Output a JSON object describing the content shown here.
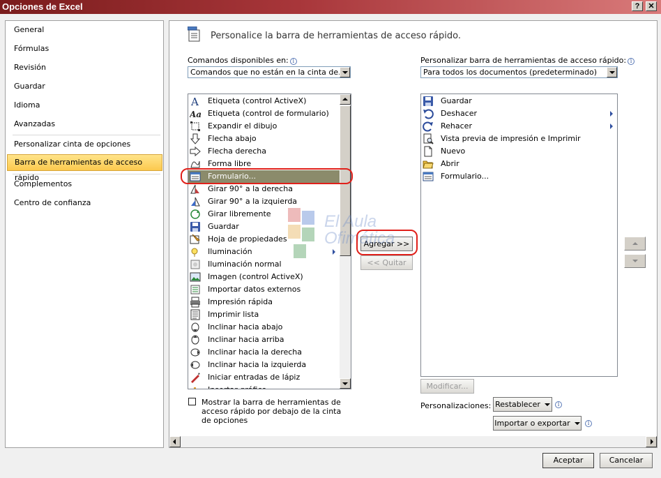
{
  "window": {
    "title": "Opciones de Excel",
    "help_button": "?",
    "close_button": "✕"
  },
  "nav": {
    "items": [
      {
        "label": "General"
      },
      {
        "label": "Fórmulas"
      },
      {
        "label": "Revisión"
      },
      {
        "label": "Guardar"
      },
      {
        "label": "Idioma"
      },
      {
        "label": "Avanzadas"
      },
      {
        "label": "Personalizar cinta de opciones"
      },
      {
        "label": "Barra de herramientas de acceso rápido",
        "selected": true
      },
      {
        "label": "Complementos"
      },
      {
        "label": "Centro de confianza"
      }
    ]
  },
  "header": {
    "title": "Personalice la barra de herramientas de acceso rápido."
  },
  "left": {
    "label": "Comandos disponibles en:",
    "select_value": "Comandos que no están en la cinta de...",
    "items": [
      {
        "label": "Etiqueta (control ActiveX)",
        "icon": "letter-a-icon"
      },
      {
        "label": "Etiqueta (control de formulario)",
        "icon": "letter-aa-icon"
      },
      {
        "label": "Expandir el dibujo",
        "icon": "expand-icon"
      },
      {
        "label": "Flecha abajo",
        "icon": "arrow-down-icon"
      },
      {
        "label": "Flecha derecha",
        "icon": "arrow-right-icon"
      },
      {
        "label": "Forma libre",
        "icon": "freeform-icon"
      },
      {
        "label": "Formulario...",
        "icon": "form-icon",
        "selected": true
      },
      {
        "label": "Girar 90° a la derecha",
        "icon": "rotate-right-icon"
      },
      {
        "label": "Girar 90° a la izquierda",
        "icon": "rotate-left-icon"
      },
      {
        "label": "Girar libremente",
        "icon": "free-rotate-icon"
      },
      {
        "label": "Guardar",
        "icon": "save-icon"
      },
      {
        "label": "Hoja de propiedades",
        "icon": "properties-icon"
      },
      {
        "label": "Iluminación",
        "icon": "lighting-icon",
        "submenu": true
      },
      {
        "label": "Iluminación normal",
        "icon": "lighting-normal-icon"
      },
      {
        "label": "Imagen (control ActiveX)",
        "icon": "image-icon"
      },
      {
        "label": "Importar datos externos",
        "icon": "import-icon"
      },
      {
        "label": "Impresión rápida",
        "icon": "quick-print-icon"
      },
      {
        "label": "Imprimir lista",
        "icon": "print-list-icon"
      },
      {
        "label": "Inclinar hacia abajo",
        "icon": "tilt-down-icon"
      },
      {
        "label": "Inclinar hacia arriba",
        "icon": "tilt-up-icon"
      },
      {
        "label": "Inclinar hacia la derecha",
        "icon": "tilt-right-icon"
      },
      {
        "label": "Inclinar hacia la izquierda",
        "icon": "tilt-left-icon"
      },
      {
        "label": "Iniciar entradas de lápiz",
        "icon": "ink-icon"
      },
      {
        "label": "Insertar gráfico",
        "icon": "chart-icon"
      }
    ],
    "show_below_label": "Mostrar la barra de herramientas de acceso rápido por debajo de la cinta de opciones"
  },
  "middle": {
    "add_label": "Agregar >>",
    "remove_label": "<< Quitar"
  },
  "right": {
    "label": "Personalizar barra de herramientas de acceso rápido:",
    "select_value": "Para todos los documentos (predeterminado)",
    "items": [
      {
        "label": "Guardar",
        "icon": "save-icon"
      },
      {
        "label": "Deshacer",
        "icon": "undo-icon",
        "submenu": true
      },
      {
        "label": "Rehacer",
        "icon": "redo-icon",
        "submenu": true
      },
      {
        "label": "Vista previa de impresión e Imprimir",
        "icon": "print-preview-icon"
      },
      {
        "label": "Nuevo",
        "icon": "new-icon"
      },
      {
        "label": "Abrir",
        "icon": "open-icon"
      },
      {
        "label": "Formulario...",
        "icon": "form-icon"
      }
    ],
    "modify_label": "Modificar...",
    "customizations_label": "Personalizaciones:",
    "reset_label": "Restablecer",
    "import_export_label": "Importar o exportar"
  },
  "footer": {
    "ok_label": "Aceptar",
    "cancel_label": "Cancelar"
  },
  "watermark": {
    "line1": "El Aula",
    "line2": "Ofimática"
  },
  "colors": {
    "title_bar": "#a8363a",
    "nav_selected": "#fcc94e",
    "list_selected": "#8b8b6b",
    "annotation": "#e0201a"
  }
}
